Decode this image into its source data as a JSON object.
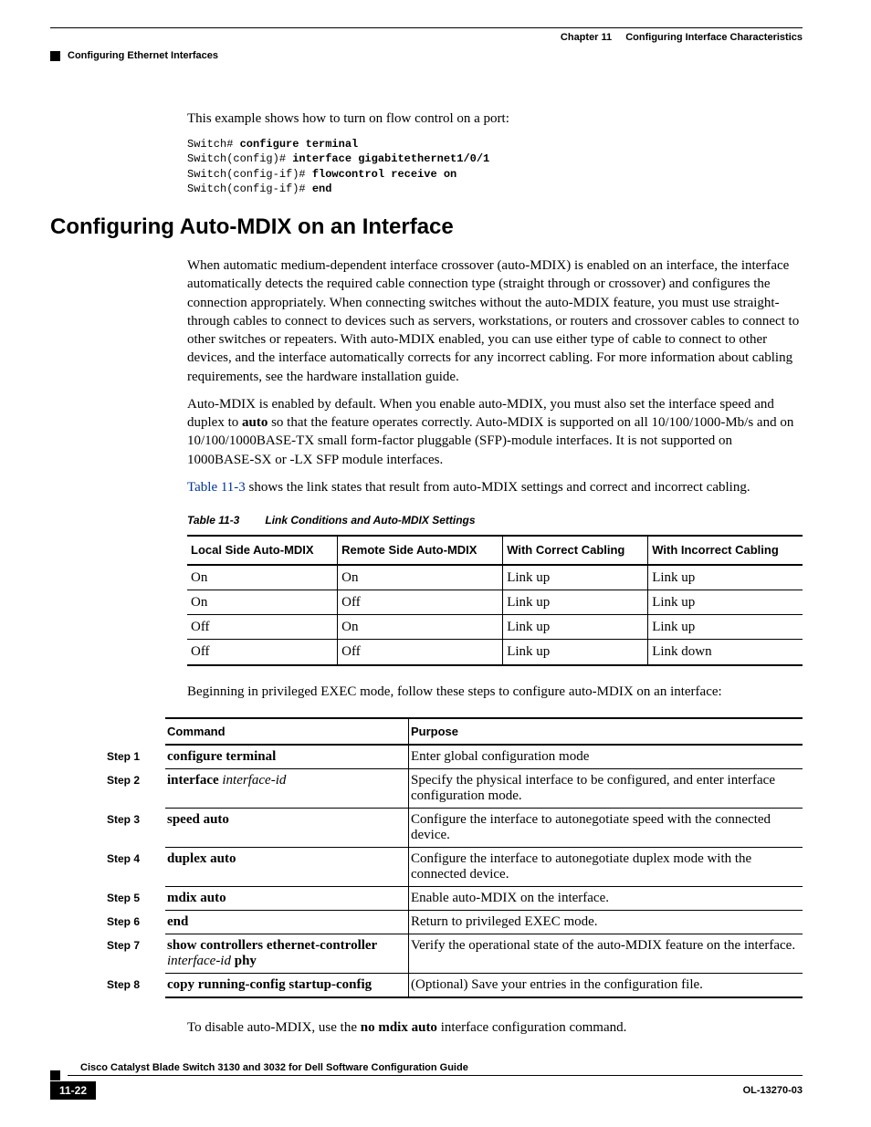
{
  "header": {
    "chapter": "Chapter 11",
    "chapter_title": "Configuring Interface Characteristics",
    "section": "Configuring Ethernet Interfaces"
  },
  "intro": {
    "p1": "This example shows how to turn on flow control on a port:",
    "code_l1a": "Switch# ",
    "code_l1b": "configure terminal",
    "code_l2a": "Switch(config)# ",
    "code_l2b": "interface gigabitethernet1/0/1",
    "code_l3a": "Switch(config-if)# ",
    "code_l3b": "flowcontrol receive on",
    "code_l4a": "Switch(config-if)# ",
    "code_l4b": "end"
  },
  "section_heading": "Configuring Auto-MDIX on an Interface",
  "para1": "When automatic medium-dependent interface crossover (auto-MDIX) is enabled on an interface, the interface automatically detects the required cable connection type (straight through or crossover) and configures the connection appropriately. When connecting switches without the auto-MDIX feature, you must use straight-through cables to connect to devices such as servers, workstations, or routers and crossover cables to connect to other switches or repeaters. With auto-MDIX enabled, you can use either type of cable to connect to other devices, and the interface automatically corrects for any incorrect cabling. For more information about cabling requirements, see the hardware installation guide.",
  "para2_a": "Auto-MDIX is enabled by default. When you enable auto-MDIX, you must also set the interface speed and duplex to ",
  "para2_bold": "auto",
  "para2_b": " so that the feature operates correctly. Auto-MDIX is supported on all 10/100/1000-Mb/s and on 10/100/1000BASE-TX small form-factor pluggable (SFP)-module interfaces. It is not supported on 1000BASE-SX or -LX SFP module interfaces.",
  "para3_link": "Table 11-3",
  "para3_rest": " shows the link states that result from auto-MDIX settings and correct and incorrect cabling.",
  "table_caption_num": "Table 11-3",
  "table_caption_title": "Link Conditions and Auto-MDIX Settings",
  "table1": {
    "headers": [
      "Local Side Auto-MDIX",
      "Remote Side Auto-MDIX",
      "With Correct Cabling",
      "With Incorrect Cabling"
    ],
    "rows": [
      [
        "On",
        "On",
        "Link up",
        "Link up"
      ],
      [
        "On",
        "Off",
        "Link up",
        "Link up"
      ],
      [
        "Off",
        "On",
        "Link up",
        "Link up"
      ],
      [
        "Off",
        "Off",
        "Link up",
        "Link down"
      ]
    ]
  },
  "para4": "Beginning in privileged EXEC mode, follow these steps to configure auto-MDIX on an interface:",
  "steptable": {
    "headers": [
      "",
      "Command",
      "Purpose"
    ],
    "rows": [
      {
        "step": "Step 1",
        "cmd": "configure terminal",
        "arg": "",
        "pur": "Enter global configuration mode"
      },
      {
        "step": "Step 2",
        "cmd": "interface ",
        "arg": "interface-id",
        "pur": "Specify the physical interface to be configured, and enter interface configuration mode."
      },
      {
        "step": "Step 3",
        "cmd": "speed auto",
        "arg": "",
        "pur": "Configure the interface to autonegotiate speed with the connected device."
      },
      {
        "step": "Step 4",
        "cmd": "duplex auto",
        "arg": "",
        "pur": "Configure the interface to autonegotiate duplex mode with the connected device."
      },
      {
        "step": "Step 5",
        "cmd": "mdix auto",
        "arg": "",
        "pur": "Enable auto-MDIX on the interface."
      },
      {
        "step": "Step 6",
        "cmd": "end",
        "arg": "",
        "pur": "Return to privileged EXEC mode."
      },
      {
        "step": "Step 7",
        "cmd": "show controllers ethernet-controller ",
        "arg": "interface-id ",
        "cmd2": "phy",
        "pur": "Verify the operational state of the auto-MDIX feature on the interface."
      },
      {
        "step": "Step 8",
        "cmd": "copy running-config startup-config",
        "arg": "",
        "pur": "(Optional) Save your entries in the configuration file."
      }
    ]
  },
  "para5_a": "To disable auto-MDIX, use the ",
  "para5_bold": "no mdix auto",
  "para5_b": " interface configuration command.",
  "footer": {
    "doc_title": "Cisco Catalyst Blade Switch 3130 and 3032 for Dell Software Configuration Guide",
    "page_num": "11-22",
    "doc_id": "OL-13270-03"
  }
}
